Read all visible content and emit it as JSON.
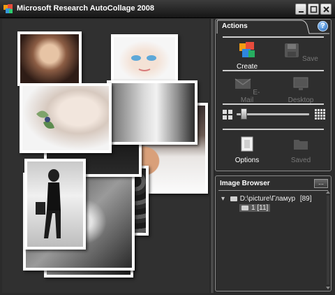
{
  "window": {
    "title": "Microsoft Research AutoCollage 2008"
  },
  "title_buttons": {
    "minimize": "minimize-icon",
    "maximize": "maximize-icon",
    "close": "close-icon"
  },
  "actions_panel": {
    "tab_label": "Actions",
    "help_label": "?",
    "buttons": [
      {
        "label": "Create",
        "icon": "create-collage-icon",
        "enabled": true
      },
      {
        "label": "Save",
        "icon": "save-icon",
        "enabled": false
      },
      {
        "label": "E-Mail",
        "icon": "email-icon",
        "enabled": false
      },
      {
        "label": "Desktop",
        "icon": "desktop-icon",
        "enabled": false
      },
      {
        "label": "Options",
        "icon": "options-icon",
        "enabled": true
      },
      {
        "label": "Saved",
        "icon": "saved-folder-icon",
        "enabled": false
      }
    ],
    "size_slider": {
      "value_fraction": 0.1
    }
  },
  "image_browser": {
    "title": "Image Browser",
    "more_button": "...",
    "root_folder": "D:\\picture\\Гламур",
    "root_count": "[89]",
    "child_folder": "1",
    "child_count": "[11]"
  },
  "colors": {
    "background": "#2b2b2b",
    "panel_border": "#8a8a8a",
    "disabled_text": "#777777"
  }
}
